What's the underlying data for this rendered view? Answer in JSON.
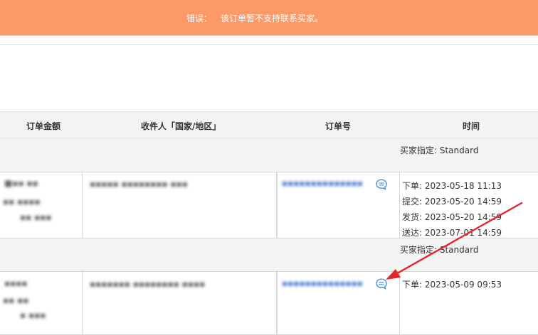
{
  "error": {
    "label": "错误：",
    "message": "该订单暂不支持联系买家。"
  },
  "table": {
    "headers": {
      "amount": "订单金额",
      "recipient": "收件人「国家/地区」",
      "order_no": "订单号",
      "time": "时间"
    }
  },
  "orders": [
    {
      "buyer_spec": "买家指定:  Standard",
      "times": [
        {
          "label": "下单:",
          "value": "2023-05-18 11:13"
        },
        {
          "label": "提交:",
          "value": "2023-05-20 14:59"
        },
        {
          "label": "发货:",
          "value": "2023-05-20 14:59"
        },
        {
          "label": "送达:",
          "value": "2023-07-01 14:59"
        }
      ]
    },
    {
      "buyer_spec": "买家指定:  Standard",
      "times": [
        {
          "label": "下单:",
          "value": "2023-05-09 09:53"
        }
      ]
    }
  ],
  "colors": {
    "banner": "#fb9a66",
    "arrow": "#e3262c",
    "link": "#4a7bd1"
  },
  "icons": {
    "chat": "chat-bubble-icon"
  }
}
